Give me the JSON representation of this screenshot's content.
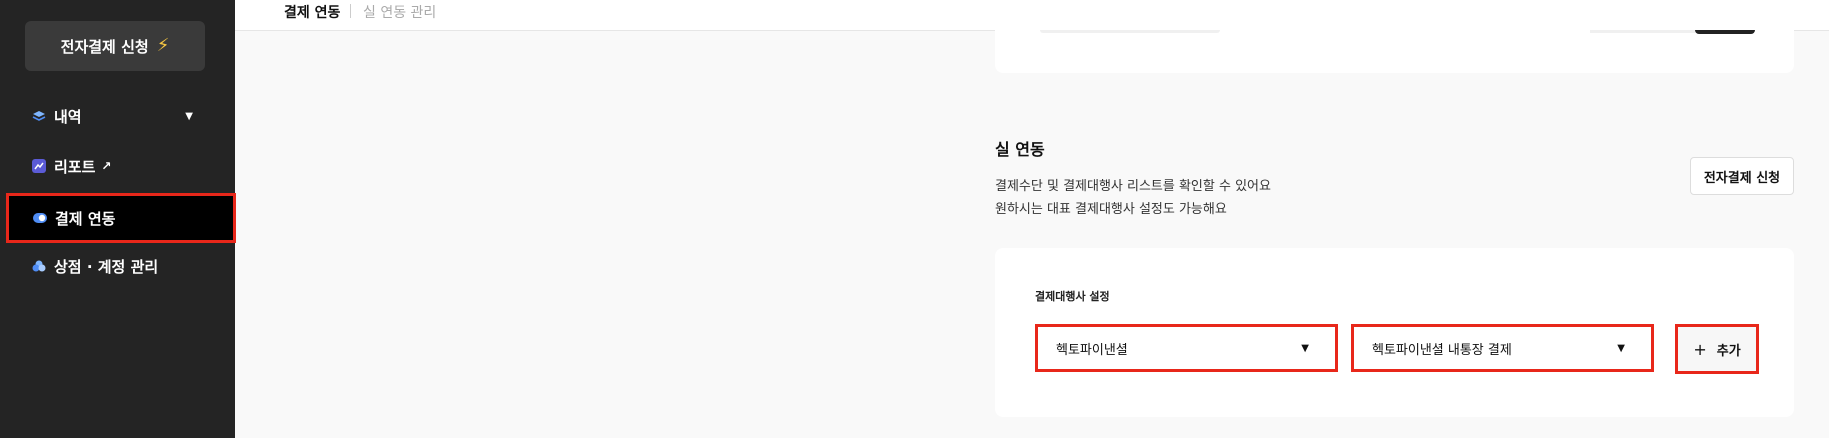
{
  "sidebar": {
    "apply_button": "전자결제 신청",
    "items": [
      {
        "label": "내역",
        "icon": "layers-icon"
      },
      {
        "label": "리포트",
        "icon": "chart-icon"
      },
      {
        "label": "결제 연동",
        "icon": "toggle-icon"
      },
      {
        "label": "상점 · 계정 관리",
        "icon": "cloud-icon"
      }
    ]
  },
  "header": {
    "tabs": [
      {
        "label": "결제 연동"
      },
      {
        "label": "실 연동 관리"
      }
    ]
  },
  "main": {
    "section_title": "실 연동",
    "desc_line1": "결제수단 및 결제대행사 리스트를 확인할 수 있어요",
    "desc_line2": "원하시는 대표 결제대행사 설정도 가능해요",
    "apply_button": "전자결제 신청",
    "card": {
      "label": "결제대행사 설정",
      "select1": "헥토파이낸셜",
      "select2": "헥토파이낸셜 내통장 결제",
      "add_button": "추가"
    }
  },
  "colors": {
    "sidebar_bg": "#242424",
    "highlight": "#e8271a",
    "bolt": "#f5c542"
  }
}
